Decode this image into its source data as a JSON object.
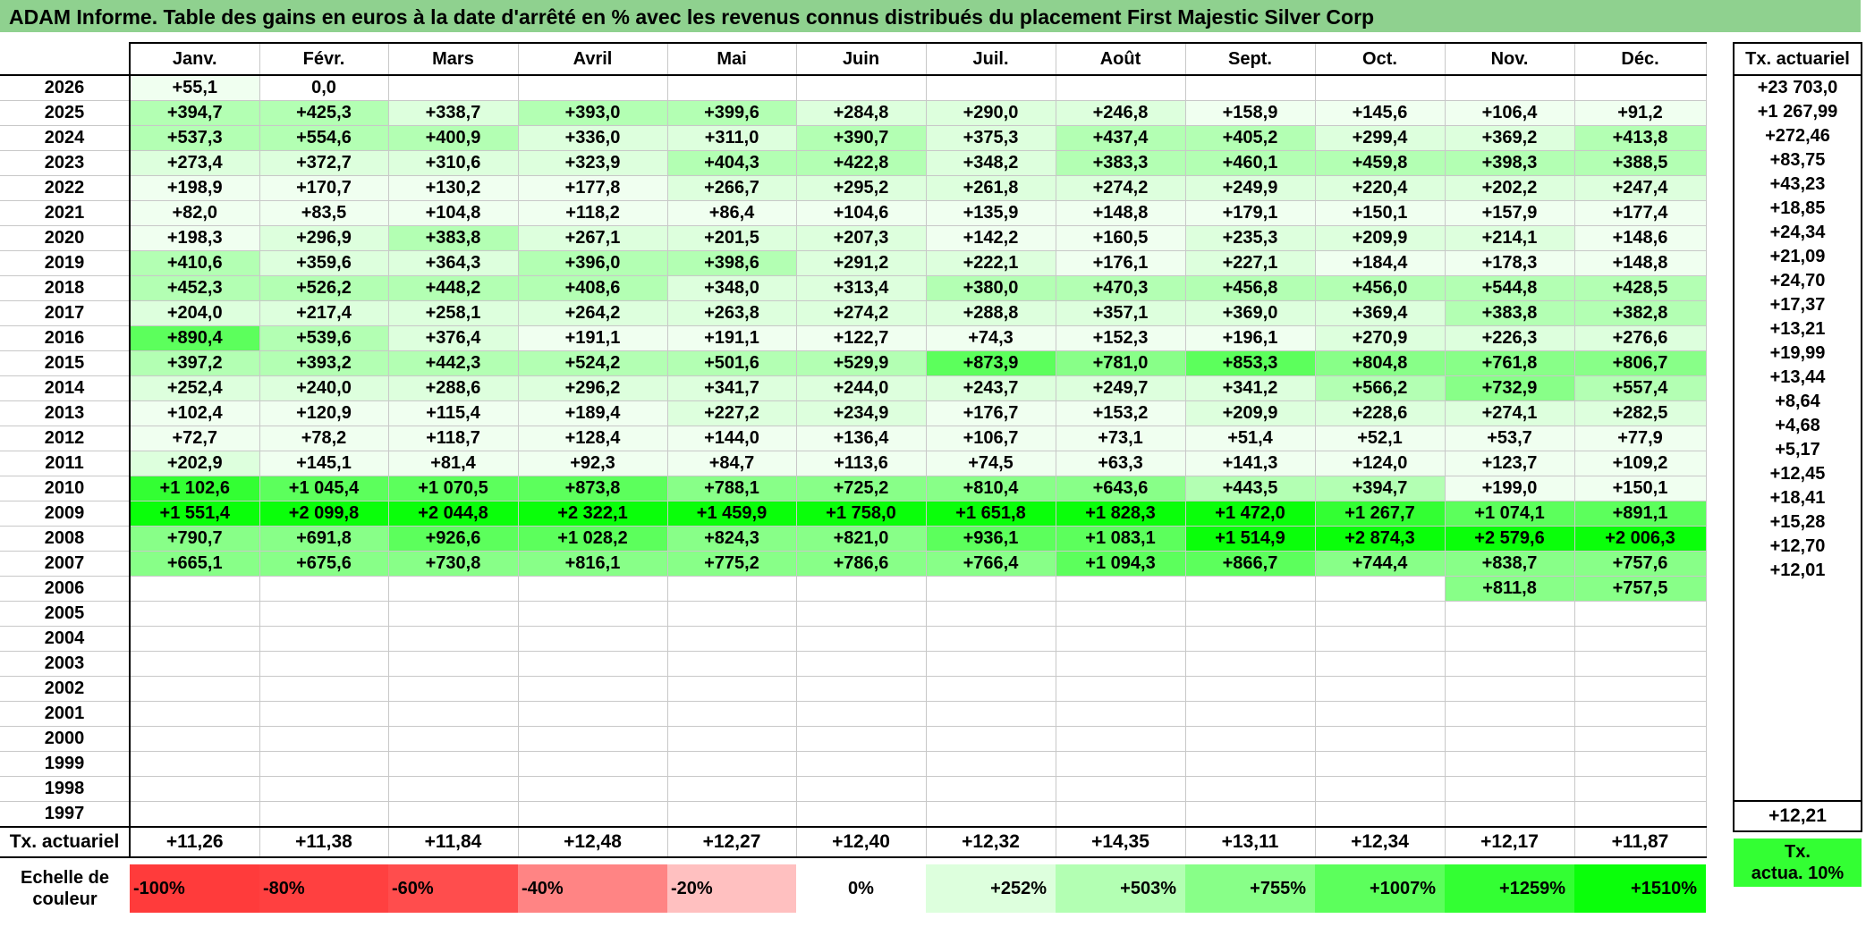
{
  "title": "ADAM Informe. Table des gains en euros à la date d'arrêté en % avec les revenus connus distribués du placement First Majestic Silver Corp",
  "months": [
    "Janv.",
    "Févr.",
    "Mars",
    "Avril",
    "Mai",
    "Juin",
    "Juil.",
    "Août",
    "Sept.",
    "Oct.",
    "Nov.",
    "Déc."
  ],
  "actuarial_header": "Tx. actuariel",
  "rows": [
    {
      "year": "2026",
      "values": [
        "+55,1",
        "0,0",
        "",
        "",
        "",
        "",
        "",
        "",
        "",
        "",
        "",
        ""
      ],
      "rate": "+23 703,0"
    },
    {
      "year": "2025",
      "values": [
        "+394,7",
        "+425,3",
        "+338,7",
        "+393,0",
        "+399,6",
        "+284,8",
        "+290,0",
        "+246,8",
        "+158,9",
        "+145,6",
        "+106,4",
        "+91,2"
      ],
      "rate": "+1 267,99"
    },
    {
      "year": "2024",
      "values": [
        "+537,3",
        "+554,6",
        "+400,9",
        "+336,0",
        "+311,0",
        "+390,7",
        "+375,3",
        "+437,4",
        "+405,2",
        "+299,4",
        "+369,2",
        "+413,8"
      ],
      "rate": "+272,46"
    },
    {
      "year": "2023",
      "values": [
        "+273,4",
        "+372,7",
        "+310,6",
        "+323,9",
        "+404,3",
        "+422,8",
        "+348,2",
        "+383,3",
        "+460,1",
        "+459,8",
        "+398,3",
        "+388,5"
      ],
      "rate": "+83,75"
    },
    {
      "year": "2022",
      "values": [
        "+198,9",
        "+170,7",
        "+130,2",
        "+177,8",
        "+266,7",
        "+295,2",
        "+261,8",
        "+274,2",
        "+249,9",
        "+220,4",
        "+202,2",
        "+247,4"
      ],
      "rate": "+43,23"
    },
    {
      "year": "2021",
      "values": [
        "+82,0",
        "+83,5",
        "+104,8",
        "+118,2",
        "+86,4",
        "+104,6",
        "+135,9",
        "+148,8",
        "+179,1",
        "+150,1",
        "+157,9",
        "+177,4"
      ],
      "rate": "+18,85"
    },
    {
      "year": "2020",
      "values": [
        "+198,3",
        "+296,9",
        "+383,8",
        "+267,1",
        "+201,5",
        "+207,3",
        "+142,2",
        "+160,5",
        "+235,3",
        "+209,9",
        "+214,1",
        "+148,6"
      ],
      "rate": "+24,34"
    },
    {
      "year": "2019",
      "values": [
        "+410,6",
        "+359,6",
        "+364,3",
        "+396,0",
        "+398,6",
        "+291,2",
        "+222,1",
        "+176,1",
        "+227,1",
        "+184,4",
        "+178,3",
        "+148,8"
      ],
      "rate": "+21,09"
    },
    {
      "year": "2018",
      "values": [
        "+452,3",
        "+526,2",
        "+448,2",
        "+408,6",
        "+348,0",
        "+313,4",
        "+380,0",
        "+470,3",
        "+456,8",
        "+456,0",
        "+544,8",
        "+428,5"
      ],
      "rate": "+24,70"
    },
    {
      "year": "2017",
      "values": [
        "+204,0",
        "+217,4",
        "+258,1",
        "+264,2",
        "+263,8",
        "+274,2",
        "+288,8",
        "+357,1",
        "+369,0",
        "+369,4",
        "+383,8",
        "+382,8"
      ],
      "rate": "+17,37"
    },
    {
      "year": "2016",
      "values": [
        "+890,4",
        "+539,6",
        "+376,4",
        "+191,1",
        "+191,1",
        "+122,7",
        "+74,3",
        "+152,3",
        "+196,1",
        "+270,9",
        "+226,3",
        "+276,6"
      ],
      "rate": "+13,21"
    },
    {
      "year": "2015",
      "values": [
        "+397,2",
        "+393,2",
        "+442,3",
        "+524,2",
        "+501,6",
        "+529,9",
        "+873,9",
        "+781,0",
        "+853,3",
        "+804,8",
        "+761,8",
        "+806,7"
      ],
      "rate": "+19,99"
    },
    {
      "year": "2014",
      "values": [
        "+252,4",
        "+240,0",
        "+288,6",
        "+296,2",
        "+341,7",
        "+244,0",
        "+243,7",
        "+249,7",
        "+341,2",
        "+566,2",
        "+732,9",
        "+557,4"
      ],
      "rate": "+13,44"
    },
    {
      "year": "2013",
      "values": [
        "+102,4",
        "+120,9",
        "+115,4",
        "+189,4",
        "+227,2",
        "+234,9",
        "+176,7",
        "+153,2",
        "+209,9",
        "+228,6",
        "+274,1",
        "+282,5"
      ],
      "rate": "+8,64"
    },
    {
      "year": "2012",
      "values": [
        "+72,7",
        "+78,2",
        "+118,7",
        "+128,4",
        "+144,0",
        "+136,4",
        "+106,7",
        "+73,1",
        "+51,4",
        "+52,1",
        "+53,7",
        "+77,9"
      ],
      "rate": "+4,68"
    },
    {
      "year": "2011",
      "values": [
        "+202,9",
        "+145,1",
        "+81,4",
        "+92,3",
        "+84,7",
        "+113,6",
        "+74,5",
        "+63,3",
        "+141,3",
        "+124,0",
        "+123,7",
        "+109,2"
      ],
      "rate": "+5,17"
    },
    {
      "year": "2010",
      "values": [
        "+1 102,6",
        "+1 045,4",
        "+1 070,5",
        "+873,8",
        "+788,1",
        "+725,2",
        "+810,4",
        "+643,6",
        "+443,5",
        "+394,7",
        "+199,0",
        "+150,1"
      ],
      "rate": "+12,45"
    },
    {
      "year": "2009",
      "values": [
        "+1 551,4",
        "+2 099,8",
        "+2 044,8",
        "+2 322,1",
        "+1 459,9",
        "+1 758,0",
        "+1 651,8",
        "+1 828,3",
        "+1 472,0",
        "+1 267,7",
        "+1 074,1",
        "+891,1"
      ],
      "rate": "+18,41"
    },
    {
      "year": "2008",
      "values": [
        "+790,7",
        "+691,8",
        "+926,6",
        "+1 028,2",
        "+824,3",
        "+821,0",
        "+936,1",
        "+1 083,1",
        "+1 514,9",
        "+2 874,3",
        "+2 579,6",
        "+2 006,3"
      ],
      "rate": "+15,28"
    },
    {
      "year": "2007",
      "values": [
        "+665,1",
        "+675,6",
        "+730,8",
        "+816,1",
        "+775,2",
        "+786,6",
        "+766,4",
        "+1 094,3",
        "+866,7",
        "+744,4",
        "+838,7",
        "+757,6"
      ],
      "rate": "+12,70"
    },
    {
      "year": "2006",
      "values": [
        "",
        "",
        "",
        "",
        "",
        "",
        "",
        "",
        "",
        "",
        "+811,8",
        "+757,5"
      ],
      "rate": "+12,01"
    },
    {
      "year": "2005",
      "values": [
        "",
        "",
        "",
        "",
        "",
        "",
        "",
        "",
        "",
        "",
        "",
        ""
      ],
      "rate": ""
    },
    {
      "year": "2004",
      "values": [
        "",
        "",
        "",
        "",
        "",
        "",
        "",
        "",
        "",
        "",
        "",
        ""
      ],
      "rate": ""
    },
    {
      "year": "2003",
      "values": [
        "",
        "",
        "",
        "",
        "",
        "",
        "",
        "",
        "",
        "",
        "",
        ""
      ],
      "rate": ""
    },
    {
      "year": "2002",
      "values": [
        "",
        "",
        "",
        "",
        "",
        "",
        "",
        "",
        "",
        "",
        "",
        ""
      ],
      "rate": ""
    },
    {
      "year": "2001",
      "values": [
        "",
        "",
        "",
        "",
        "",
        "",
        "",
        "",
        "",
        "",
        "",
        ""
      ],
      "rate": ""
    },
    {
      "year": "2000",
      "values": [
        "",
        "",
        "",
        "",
        "",
        "",
        "",
        "",
        "",
        "",
        "",
        ""
      ],
      "rate": ""
    },
    {
      "year": "1999",
      "values": [
        "",
        "",
        "",
        "",
        "",
        "",
        "",
        "",
        "",
        "",
        "",
        ""
      ],
      "rate": ""
    },
    {
      "year": "1998",
      "values": [
        "",
        "",
        "",
        "",
        "",
        "",
        "",
        "",
        "",
        "",
        "",
        ""
      ],
      "rate": ""
    },
    {
      "year": "1997",
      "values": [
        "",
        "",
        "",
        "",
        "",
        "",
        "",
        "",
        "",
        "",
        "",
        ""
      ],
      "rate": ""
    }
  ],
  "monthly_actuarial": {
    "label": "Tx. actuariel",
    "values": [
      "+11,26",
      "+11,38",
      "+11,84",
      "+12,48",
      "+12,27",
      "+12,40",
      "+12,32",
      "+14,35",
      "+13,11",
      "+12,34",
      "+12,17",
      "+11,87"
    ],
    "total": "+12,21"
  },
  "color_scale": {
    "label_line1": "Echelle de",
    "label_line2": "couleur",
    "steps": [
      {
        "label": "-100%",
        "color": "#ff3b3b"
      },
      {
        "label": "-80%",
        "color": "#ff4040"
      },
      {
        "label": "-60%",
        "color": "#ff4d4d"
      },
      {
        "label": "-40%",
        "color": "#ff8484"
      },
      {
        "label": "-20%",
        "color": "#ffc0c0"
      },
      {
        "label": "0%",
        "color": "#ffffff"
      },
      {
        "label": "+252%",
        "color": "#ddffdd"
      },
      {
        "label": "+503%",
        "color": "#b3ffb3"
      },
      {
        "label": "+755%",
        "color": "#88ff88"
      },
      {
        "label": "+1007%",
        "color": "#5cff5c"
      },
      {
        "label": "+1259%",
        "color": "#33ff33"
      },
      {
        "label": "+1510%",
        "color": "#0aff0a"
      }
    ],
    "legend_line1": "Tx.",
    "legend_line2": "actua. 10%"
  }
}
